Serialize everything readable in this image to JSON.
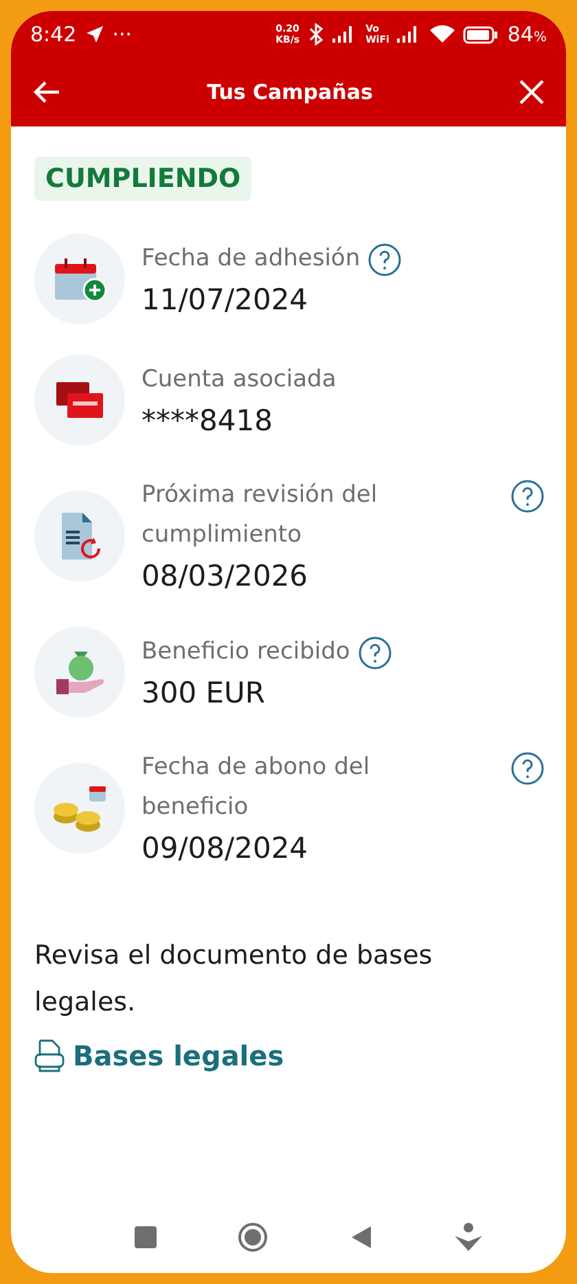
{
  "status_bar": {
    "time": "8:42",
    "dots": "···",
    "net_speed": "0.20",
    "net_unit": "KB/s",
    "volte_top": "Vo",
    "volte_bottom": "WiFi",
    "battery_level_text": "84",
    "battery_unit": "%"
  },
  "header": {
    "title": "Tus Campañas"
  },
  "status_badge": "CUMPLIENDO",
  "fields": [
    {
      "kind": "calendar",
      "label": "Fecha de adhesión",
      "value": "11/07/2024",
      "help": true,
      "help_right": false
    },
    {
      "kind": "cards",
      "label": "Cuenta asociada",
      "value": "****8418",
      "help": false
    },
    {
      "kind": "document",
      "label": "Próxima revisión del cumplimiento",
      "value": "08/03/2026",
      "help": true,
      "help_right": true
    },
    {
      "kind": "money",
      "label": "Beneficio recibido",
      "value": "300 EUR",
      "help": true,
      "help_right": false
    },
    {
      "kind": "coins",
      "label": "Fecha de abono del beneficio",
      "value": "09/08/2024",
      "help": true,
      "help_right": true
    }
  ],
  "legal_text": "Revisa el documento de bases legales.",
  "legal_link": "Bases legales"
}
